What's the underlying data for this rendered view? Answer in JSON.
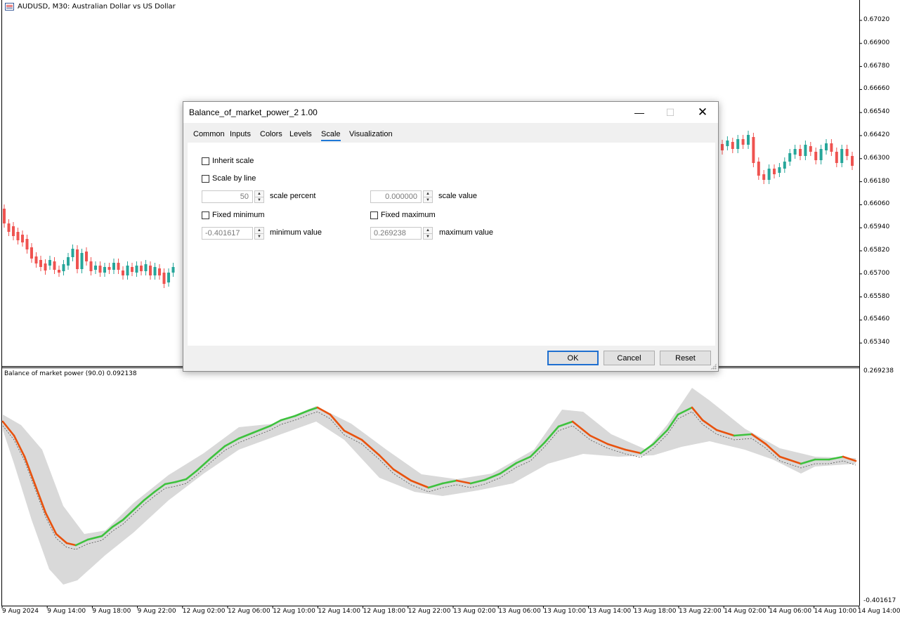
{
  "chart": {
    "title": "AUDUSD, M30:  Australian Dollar vs US Dollar",
    "price_axis": [
      "0.67020",
      "0.66900",
      "0.66780",
      "0.66660",
      "0.66540",
      "0.66420",
      "0.66300",
      "0.66180",
      "0.66060",
      "0.65940",
      "0.65820",
      "0.65700",
      "0.65580",
      "0.65460",
      "0.65340"
    ],
    "time_axis": [
      "9 Aug 2024",
      "9 Aug 14:00",
      "9 Aug 18:00",
      "9 Aug 22:00",
      "12 Aug 02:00",
      "12 Aug 06:00",
      "12 Aug 10:00",
      "12 Aug 14:00",
      "12 Aug 18:00",
      "12 Aug 22:00",
      "13 Aug 02:00",
      "13 Aug 06:00",
      "13 Aug 10:00",
      "13 Aug 14:00",
      "13 Aug 18:00",
      "13 Aug 22:00",
      "14 Aug 02:00",
      "14 Aug 06:00",
      "14 Aug 10:00",
      "14 Aug 14:00"
    ],
    "colors": {
      "bull": "#26a69a",
      "bear": "#ef5350",
      "up_line": "#3ec23e",
      "down_line": "#e8520e",
      "band": "#d8d8d8"
    }
  },
  "indicator": {
    "label": "Balance of market power (90.0) 0.092138",
    "max_label": "0.269238",
    "min_label": "-0.401617"
  },
  "dialog": {
    "title": "Balance_of_market_power_2 1.00",
    "tabs": [
      "Common",
      "Inputs",
      "Colors",
      "Levels",
      "Scale",
      "Visualization"
    ],
    "active_tab": "Scale",
    "inherit_scale": "Inherit scale",
    "scale_by_line": "Scale by line",
    "scale_percent_value": "50",
    "scale_percent_label": "scale percent",
    "scale_value_value": "0.000000",
    "scale_value_label": "scale value",
    "fixed_minimum": "Fixed minimum",
    "fixed_maximum": "Fixed maximum",
    "minimum_value": "-0.401617",
    "minimum_label": "minimum value",
    "maximum_value": "0.269238",
    "maximum_label": "maximum value",
    "ok": "OK",
    "cancel": "Cancel",
    "reset": "Reset",
    "icons": {
      "minimize": "minimize-icon",
      "maximize": "maximize-icon",
      "close": "close-icon"
    }
  }
}
